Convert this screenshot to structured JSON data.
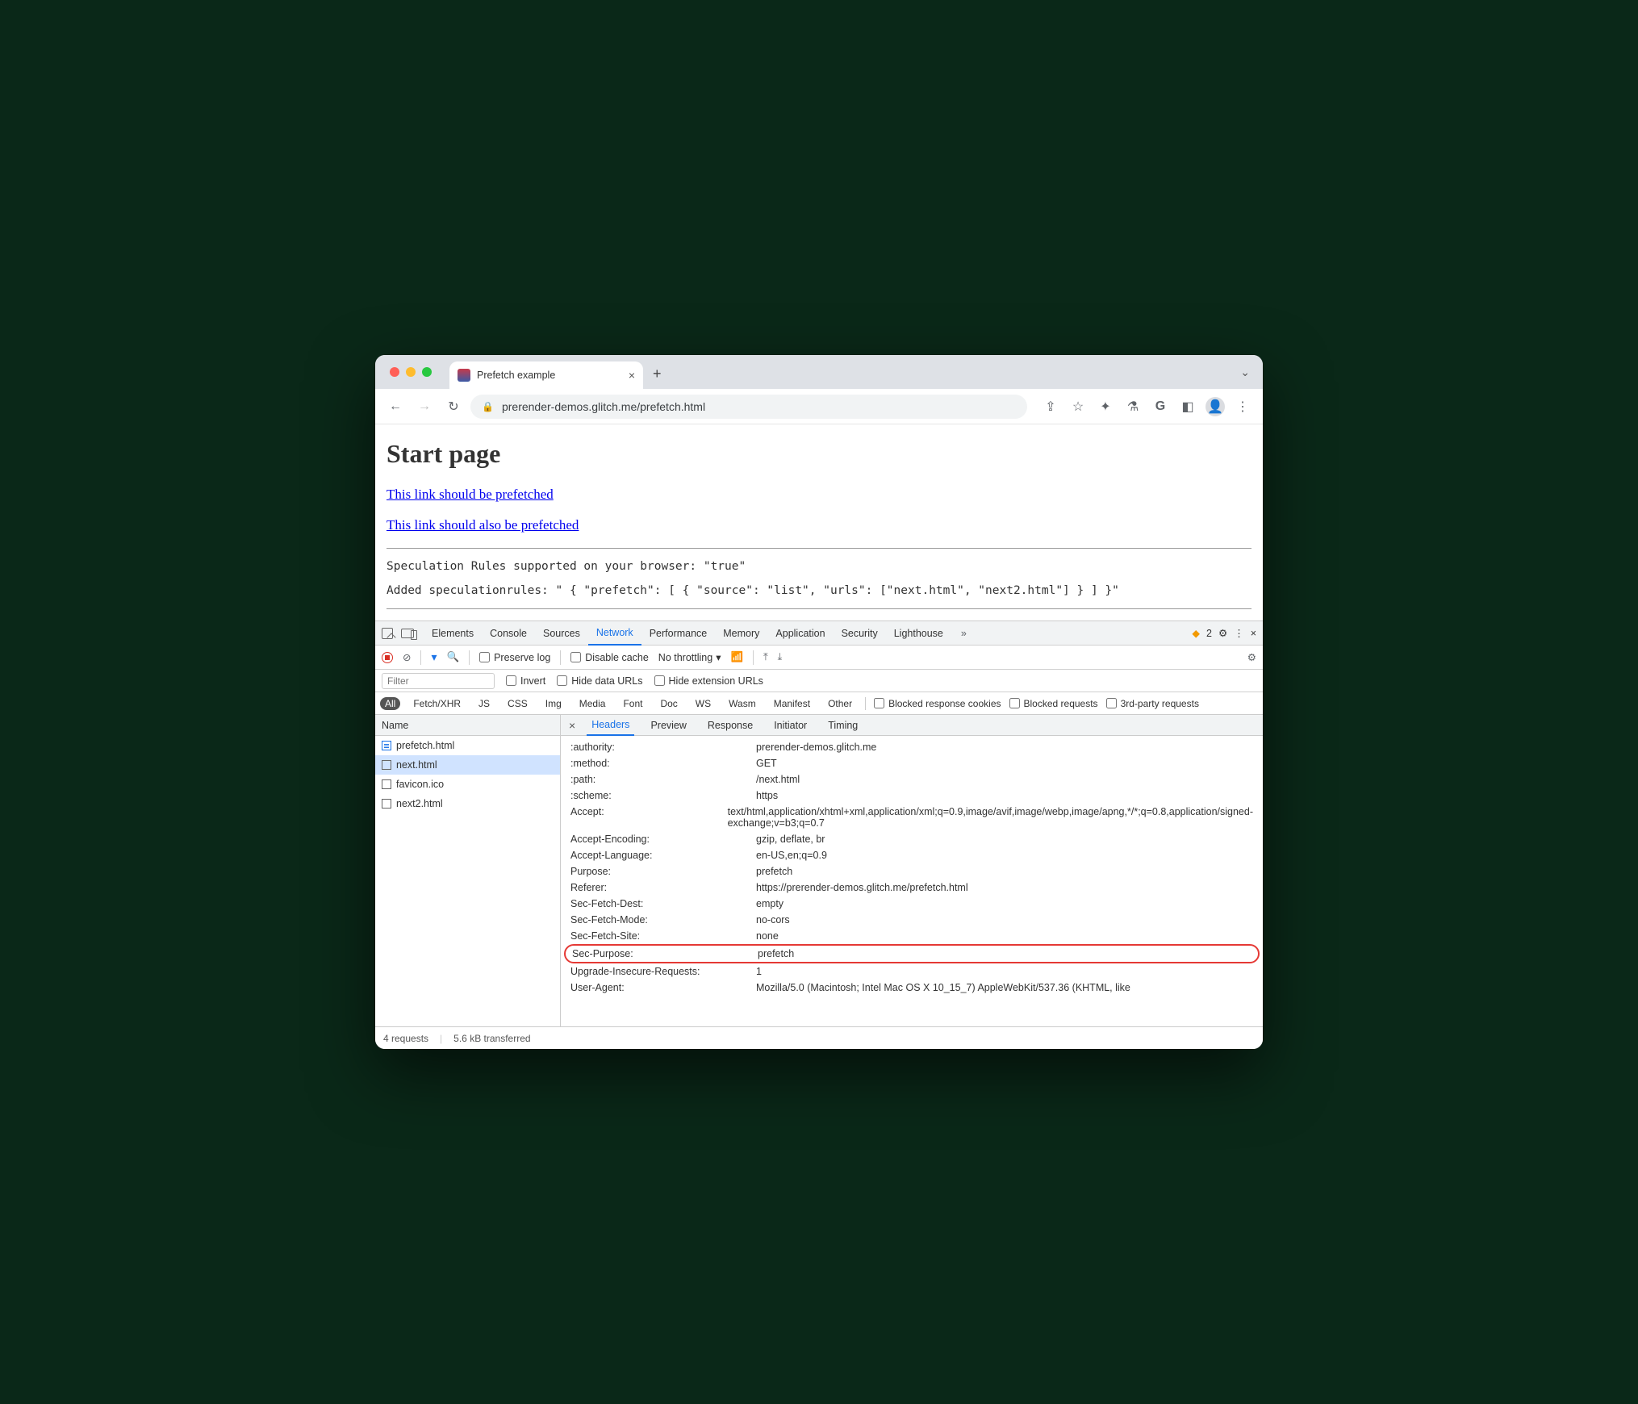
{
  "window": {
    "tab_title": "Prefetch example",
    "url_display": "prerender-demos.glitch.me/prefetch.html"
  },
  "page": {
    "heading": "Start page",
    "link1": "This link should be prefetched",
    "link2": "This link should also be prefetched",
    "status1": "Speculation Rules supported on your browser: \"true\"",
    "status2": "Added speculationrules: \" { \"prefetch\": [ { \"source\": \"list\", \"urls\": [\"next.html\", \"next2.html\"] } ] }\""
  },
  "devtools": {
    "tabs": [
      "Elements",
      "Console",
      "Sources",
      "Network",
      "Performance",
      "Memory",
      "Application",
      "Security",
      "Lighthouse"
    ],
    "active_tab": "Network",
    "more_count": "2",
    "toolbar": {
      "preserve_log": "Preserve log",
      "disable_cache": "Disable cache",
      "throttling": "No throttling"
    },
    "filter_placeholder": "Filter",
    "filter_checks": {
      "invert": "Invert",
      "hidedata": "Hide data URLs",
      "hideext": "Hide extension URLs"
    },
    "type_filters": [
      "All",
      "Fetch/XHR",
      "JS",
      "CSS",
      "Img",
      "Media",
      "Font",
      "Doc",
      "WS",
      "Wasm",
      "Manifest",
      "Other"
    ],
    "type_checks": {
      "blockedcookies": "Blocked response cookies",
      "blockedreq": "Blocked requests",
      "thirdparty": "3rd-party requests"
    },
    "name_col": "Name",
    "panel_tabs": [
      "Headers",
      "Preview",
      "Response",
      "Initiator",
      "Timing"
    ],
    "active_panel": "Headers",
    "requests": [
      {
        "name": "prefetch.html",
        "kind": "doc"
      },
      {
        "name": "next.html",
        "kind": "plain",
        "selected": true
      },
      {
        "name": "favicon.ico",
        "kind": "plain"
      },
      {
        "name": "next2.html",
        "kind": "plain"
      }
    ],
    "headers": [
      {
        "k": ":authority:",
        "v": "prerender-demos.glitch.me"
      },
      {
        "k": ":method:",
        "v": "GET"
      },
      {
        "k": ":path:",
        "v": "/next.html"
      },
      {
        "k": ":scheme:",
        "v": "https"
      },
      {
        "k": "Accept:",
        "v": "text/html,application/xhtml+xml,application/xml;q=0.9,image/avif,image/webp,image/apng,*/*;q=0.8,application/signed-exchange;v=b3;q=0.7"
      },
      {
        "k": "Accept-Encoding:",
        "v": "gzip, deflate, br"
      },
      {
        "k": "Accept-Language:",
        "v": "en-US,en;q=0.9"
      },
      {
        "k": "Purpose:",
        "v": "prefetch"
      },
      {
        "k": "Referer:",
        "v": "https://prerender-demos.glitch.me/prefetch.html"
      },
      {
        "k": "Sec-Fetch-Dest:",
        "v": "empty"
      },
      {
        "k": "Sec-Fetch-Mode:",
        "v": "no-cors"
      },
      {
        "k": "Sec-Fetch-Site:",
        "v": "none"
      },
      {
        "k": "Sec-Purpose:",
        "v": "prefetch",
        "highlight": true
      },
      {
        "k": "Upgrade-Insecure-Requests:",
        "v": "1"
      },
      {
        "k": "User-Agent:",
        "v": "Mozilla/5.0 (Macintosh; Intel Mac OS X 10_15_7) AppleWebKit/537.36 (KHTML, like"
      }
    ],
    "statusbar": {
      "requests": "4 requests",
      "transferred": "5.6 kB transferred"
    }
  }
}
